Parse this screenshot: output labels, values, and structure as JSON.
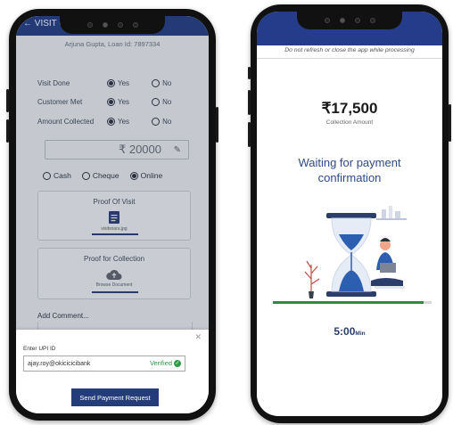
{
  "left_phone": {
    "header_back": "← VISIT CL",
    "customer_line": "Arjuna Gupta, Loan Id: 7897334",
    "questions": [
      {
        "label": "Visit Done",
        "yes": "Yes",
        "no": "No",
        "selected": "yes"
      },
      {
        "label": "Customer Met",
        "yes": "Yes",
        "no": "No",
        "selected": "yes"
      },
      {
        "label": "Amount Collected",
        "yes": "Yes",
        "no": "No",
        "selected": "yes"
      }
    ],
    "amount_value": "₹ 20000",
    "payment_modes": [
      "Cash",
      "Cheque",
      "Online"
    ],
    "payment_selected": "Online",
    "proof_of_visit": {
      "title": "Proof Of Visit",
      "file": "visitsnaru.jpg"
    },
    "proof_for_collection": {
      "title": "Proof for Collection",
      "file": "Browse Document"
    },
    "add_comment_label": "Add Comment...",
    "sheet": {
      "upi_label": "Enter UPI ID",
      "upi_value": "ajay.roy@okicicicibank",
      "verified_label": "Verified",
      "send_button": "Send Payment Request"
    }
  },
  "right_phone": {
    "banner": "Do not refresh or close the app while processing",
    "amount": "₹17,500",
    "amount_label": "Collection Amount",
    "waiting_text": "Waiting for payment confirmation",
    "progress": 0.95,
    "timer_value": "5:00",
    "timer_unit": "Min"
  },
  "colors": {
    "brand_navy": "#243d7a",
    "verified_green": "#2f9a48",
    "heading_blue": "#2d4a8a"
  }
}
